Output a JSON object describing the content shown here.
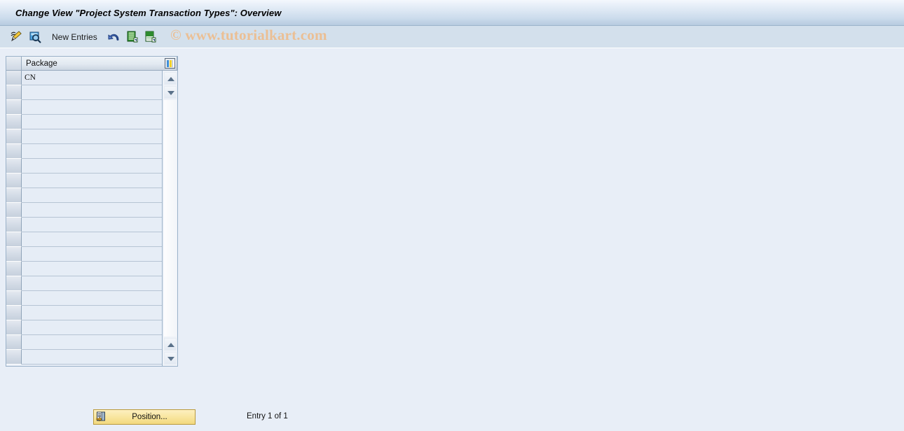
{
  "window": {
    "title": "Change View \"Project System Transaction Types\": Overview"
  },
  "toolbar": {
    "icons": [
      {
        "name": "display-change-icon",
        "title": "Display <-> Change"
      },
      {
        "name": "check-entries-icon",
        "title": "Check entries"
      }
    ],
    "new_entries_label": "New Entries",
    "action_icons": [
      {
        "name": "undo-icon",
        "title": "Undo change"
      },
      {
        "name": "copy-as-icon",
        "title": "Copy As..."
      },
      {
        "name": "variant-icon",
        "title": "Select Layout"
      }
    ]
  },
  "watermark": {
    "text": "© www.tutorialkart.com",
    "color": "#edbe90"
  },
  "table": {
    "column_header": "Package",
    "config_icon": "table-settings-icon",
    "rows": [
      {
        "package": "CN"
      },
      {
        "package": ""
      },
      {
        "package": ""
      },
      {
        "package": ""
      },
      {
        "package": ""
      },
      {
        "package": ""
      },
      {
        "package": ""
      },
      {
        "package": ""
      },
      {
        "package": ""
      },
      {
        "package": ""
      },
      {
        "package": ""
      },
      {
        "package": ""
      },
      {
        "package": ""
      },
      {
        "package": ""
      },
      {
        "package": ""
      },
      {
        "package": ""
      },
      {
        "package": ""
      },
      {
        "package": ""
      },
      {
        "package": ""
      },
      {
        "package": ""
      }
    ],
    "scrollbar": {
      "up_icon": "scroll-up-arrow-icon",
      "down_icon": "scroll-down-arrow-icon"
    }
  },
  "footer": {
    "position_button_label": "Position...",
    "position_button_icon": "position-icon",
    "entry_status": "Entry 1 of 1"
  },
  "colors": {
    "background": "#e8eef7",
    "titlebar_top": "#f4f8fd",
    "titlebar_bottom": "#b6cbe0",
    "toolbar": "#d3e0ec",
    "button_yellow": "#f8e59c",
    "grid_border": "#9bb2c9"
  }
}
